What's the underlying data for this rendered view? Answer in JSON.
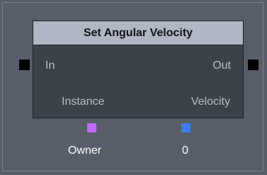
{
  "node": {
    "title": "Set Angular Velocity",
    "exec_in_label": "In",
    "exec_out_label": "Out",
    "inputs": [
      {
        "label": "Instance",
        "value": "Owner",
        "pin_color": "#c06bff"
      },
      {
        "label": "Velocity",
        "value": "0",
        "pin_color": "#3f7bff"
      }
    ]
  },
  "colors": {
    "canvas_background": "#575e6a",
    "node_body": "#3c424a",
    "node_header": "#b0b6c4",
    "exec_pin": "#000000"
  }
}
